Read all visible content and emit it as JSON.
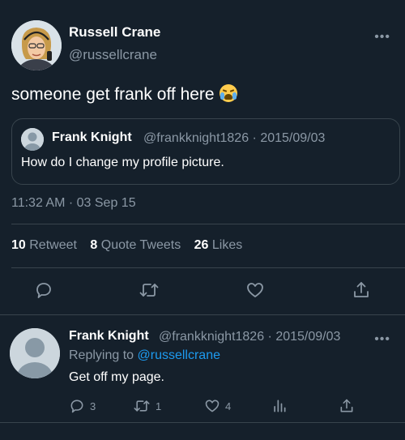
{
  "tweet": {
    "author_name": "Russell Crane",
    "author_handle": "@russellcrane",
    "text": "someone get frank off here",
    "more_label": "•••",
    "timestamp": "11:32 AM · 03 Sep 15"
  },
  "quoted_tweet": {
    "author_name": "Frank Knight",
    "meta": "@frankknight1826 · 2015/09/03",
    "text": "How do I change my profile picture."
  },
  "stats": {
    "retweets_count": "10",
    "retweets_label": "Retweet",
    "quotes_count": "8",
    "quotes_label": "Quote Tweets",
    "likes_count": "26",
    "likes_label": "Likes"
  },
  "actions": [
    "reply-icon",
    "retweet-icon",
    "like-icon",
    "share-icon"
  ],
  "reply": {
    "author_name": "Frank Knight",
    "meta": "@frankknight1826 · 2015/09/03",
    "more_label": "•••",
    "replying_prefix": "Replying to",
    "replying_handle": "@russellcrane",
    "text": "Get off my page.",
    "reply_count": "3",
    "retweet_count": "1",
    "like_count": "4"
  },
  "colors": {
    "background": "#15202b",
    "border": "#38444d",
    "secondary_text": "#8b98a5",
    "accent": "#1d9bf0"
  }
}
